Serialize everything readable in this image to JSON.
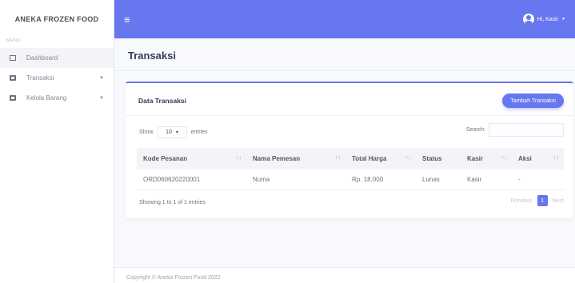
{
  "app": {
    "brand": "ANEKA FROZEN FOOD"
  },
  "sidebar": {
    "menu_heading": "MENU",
    "items": [
      {
        "label": "Dashboard",
        "icon": "square-icon"
      },
      {
        "label": "Transaksi",
        "icon": "table-icon",
        "has_dropdown": true
      },
      {
        "label": "Kelola Barang",
        "icon": "table-icon",
        "has_dropdown": true
      }
    ]
  },
  "topbar": {
    "menu_icon": "hamburger-icon",
    "user_label": "Hi, Kasir",
    "accent": "#6777ef"
  },
  "page": {
    "title": "Transaksi"
  },
  "card": {
    "title": "Data Transaksi",
    "add_button": "Tambah Transaksi",
    "show_label": "Show",
    "entries_value": "10",
    "entries_label": "entries",
    "search_label": "Search:",
    "columns": [
      "Kode Pesanan",
      "Nama Pemesan",
      "Total Harga",
      "Status",
      "Kasir",
      "Aksi"
    ],
    "rows": [
      [
        "ORD060620220001",
        "Numa",
        "Rp. 18.000",
        "Lunas",
        "Kasir",
        "-"
      ]
    ],
    "info": "Showing 1 to 1 of 1 entries",
    "pagination": {
      "previous": "Previous",
      "current": "1",
      "next": "Next"
    }
  },
  "footer": {
    "text": "Copyright © Aneka Frozen Food 2022"
  }
}
